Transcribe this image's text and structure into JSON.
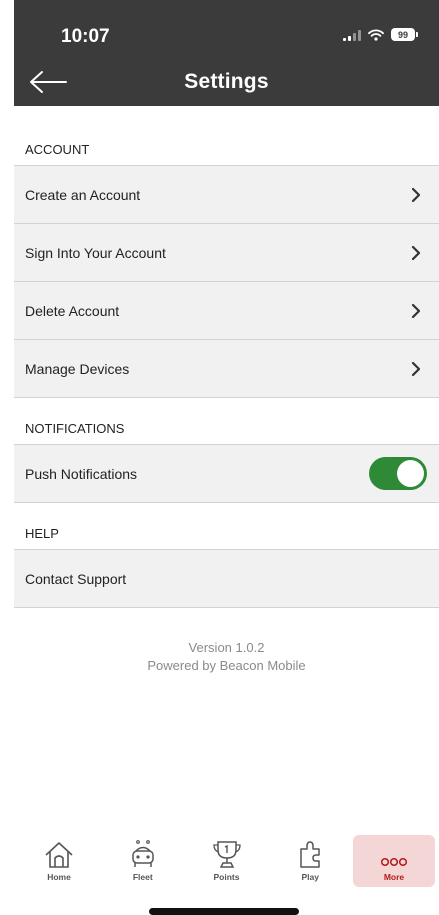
{
  "status_bar": {
    "time": "10:07",
    "battery": "99"
  },
  "header": {
    "title": "Settings"
  },
  "sections": {
    "account": {
      "label": "ACCOUNT",
      "items": [
        "Create an Account",
        "Sign Into Your Account",
        "Delete Account",
        "Manage Devices"
      ]
    },
    "notifications": {
      "label": "NOTIFICATIONS",
      "push_label": "Push Notifications",
      "push_enabled": true
    },
    "help": {
      "label": "HELP",
      "items": [
        "Contact Support"
      ]
    }
  },
  "footer": {
    "version": "Version 1.0.2",
    "powered_by": "Powered by Beacon Mobile"
  },
  "tabs": [
    {
      "label": "Home",
      "icon": "house-icon",
      "active": false
    },
    {
      "label": "Fleet",
      "icon": "car-icon",
      "active": false
    },
    {
      "label": "Points",
      "icon": "trophy-icon",
      "active": false
    },
    {
      "label": "Play",
      "icon": "puzzle-icon",
      "active": false
    },
    {
      "label": "More",
      "icon": "more-dots-icon",
      "active": true
    }
  ],
  "colors": {
    "header_bg": "#3b3b3b",
    "toggle_on": "#2e8a36",
    "active_tab_bg": "#f5d6d6",
    "active_tab_text": "#b31b1b"
  }
}
